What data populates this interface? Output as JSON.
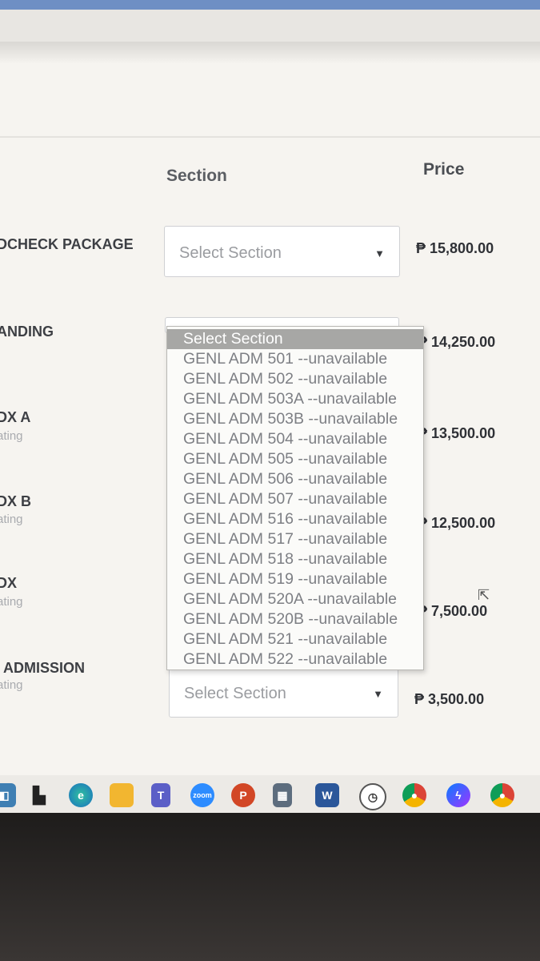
{
  "header": {
    "section_label": "Section",
    "price_label": "Price"
  },
  "packages": [
    {
      "name": "DCHECK PACKAGE",
      "sub": "",
      "price": "₱ 15,800.00"
    },
    {
      "name": "ANDING",
      "sub": "",
      "price": "₱ 14,250.00"
    },
    {
      "name": "DX A",
      "sub": "ating",
      "price": "₱ 13,500.00"
    },
    {
      "name": "DX B",
      "sub": "ating",
      "price": "₱ 12,500.00"
    },
    {
      "name": "DX",
      "sub": "ating",
      "price": "₱ 7,500.00"
    },
    {
      "name": "ADMISSION",
      "sub": "ating",
      "price": "₱ 3,500.00"
    }
  ],
  "select": {
    "placeholder": "Select Section"
  },
  "dropdown": {
    "options": [
      "Select Section",
      "GENL ADM 501 --unavailable",
      "GENL ADM 502 --unavailable",
      "GENL ADM 503A --unavailable",
      "GENL ADM 503B --unavailable",
      "GENL ADM 504 --unavailable",
      "GENL ADM 505 --unavailable",
      "GENL ADM 506 --unavailable",
      "GENL ADM 507 --unavailable",
      "GENL ADM 516 --unavailable",
      "GENL ADM 517 --unavailable",
      "GENL ADM 518 --unavailable",
      "GENL ADM 519 --unavailable",
      "GENL ADM 520A --unavailable",
      "GENL ADM 520B --unavailable",
      "GENL ADM 521 --unavailable",
      "GENL ADM 522 --unavailable"
    ]
  },
  "taskbar": {
    "icons": [
      "task-view-icon",
      "edge-icon",
      "file-explorer-icon",
      "teams-icon",
      "zoom-icon",
      "powerpoint-icon",
      "calculator-icon",
      "word-icon",
      "clock-icon",
      "chrome-icon",
      "messenger-icon",
      "chrome-profile-icon"
    ]
  }
}
